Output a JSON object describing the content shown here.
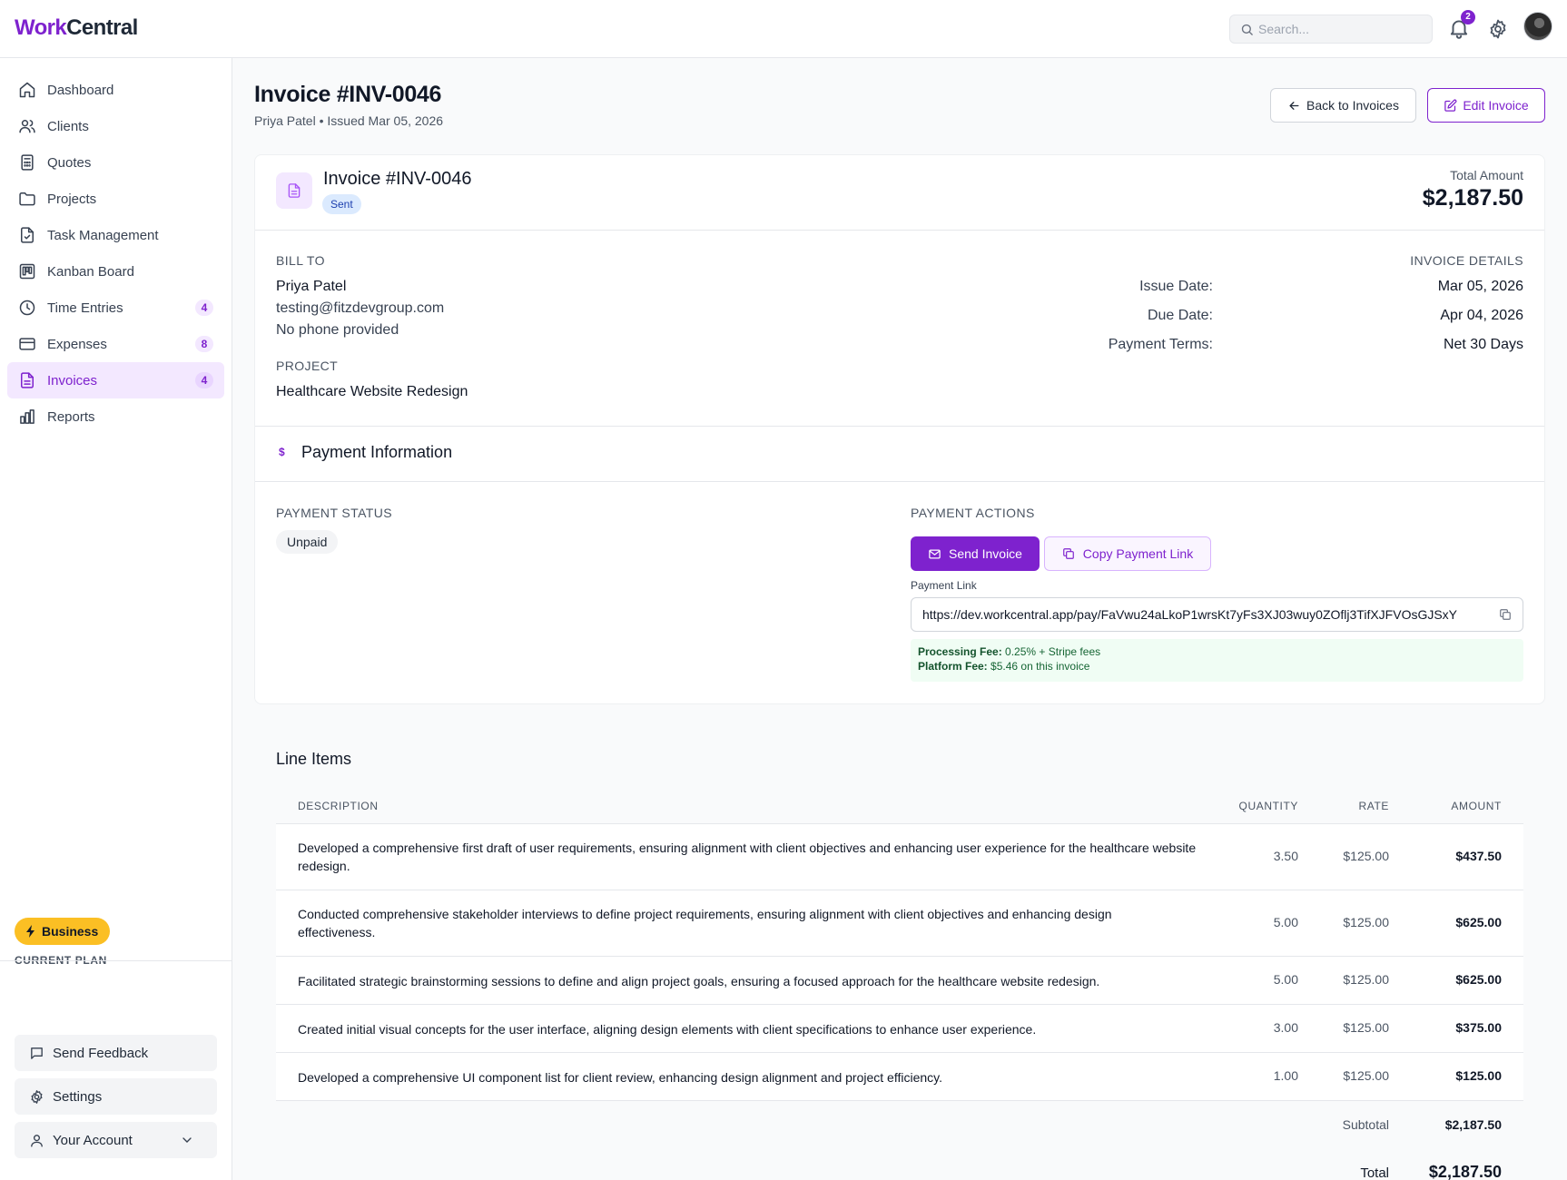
{
  "app": {
    "logo_part1": "Work",
    "logo_part2": "Central",
    "brand_color": "#7e22ce"
  },
  "topbar": {
    "search_placeholder": "Search...",
    "notification_count": "2",
    "icons": [
      "search-icon",
      "bell-icon",
      "gear-icon",
      "avatar"
    ]
  },
  "sidebar": {
    "items": [
      {
        "label": "Dashboard",
        "icon": "home-icon",
        "count": null,
        "active": false
      },
      {
        "label": "Clients",
        "icon": "users-icon",
        "count": null,
        "active": false
      },
      {
        "label": "Quotes",
        "icon": "calculator-icon",
        "count": null,
        "active": false
      },
      {
        "label": "Projects",
        "icon": "folder-icon",
        "count": null,
        "active": false
      },
      {
        "label": "Task Management",
        "icon": "file-check-icon",
        "count": null,
        "active": false
      },
      {
        "label": "Kanban Board",
        "icon": "kanban-icon",
        "count": null,
        "active": false
      },
      {
        "label": "Time Entries",
        "icon": "clock-icon",
        "count": "4",
        "active": false
      },
      {
        "label": "Expenses",
        "icon": "credit-card-icon",
        "count": "8",
        "active": false
      },
      {
        "label": "Invoices",
        "icon": "file-text-icon",
        "count": "4",
        "active": true
      },
      {
        "label": "Reports",
        "icon": "bar-chart-icon",
        "count": null,
        "active": false
      }
    ],
    "plan_label": "CURRENT PLAN",
    "plan_name": "Business",
    "feedback": "Send Feedback",
    "settings": "Settings",
    "account": "Your Account"
  },
  "header": {
    "title": "Invoice #INV-0046",
    "client": "Priya Patel",
    "separator": "•",
    "issued": "Issued Mar 05, 2026",
    "back_label": "Back to Invoices",
    "edit_label": "Edit Invoice"
  },
  "invoice": {
    "title": "Invoice #INV-0046",
    "status": "Sent",
    "total_label": "Total Amount",
    "total_value": "$2,187.50",
    "bill_to_label": "BILL TO",
    "client_name": "Priya Patel",
    "client_email": "testing@fitzdevgroup.com",
    "client_phone": "No phone provided",
    "project_label": "PROJECT",
    "project_name": "Healthcare Website Redesign",
    "details_label": "INVOICE DETAILS",
    "details": [
      {
        "key": "Issue Date:",
        "value": "Mar 05, 2026"
      },
      {
        "key": "Due Date:",
        "value": "Apr 04, 2026"
      },
      {
        "key": "Payment Terms:",
        "value": "Net 30 Days"
      }
    ]
  },
  "payment": {
    "section_icon": "$",
    "section_title": "Payment Information",
    "status_label": "PAYMENT STATUS",
    "status": "Unpaid",
    "actions_label": "PAYMENT ACTIONS",
    "send_label": "Send Invoice",
    "copy_label": "Copy Payment Link",
    "link_label": "Payment Link",
    "link_value": "https://dev.workcentral.app/pay/FaVwu24aLkoP1wrsKt7yFs3XJ03wuy0ZOflj3TifXJFVOsGJSxY",
    "processing_fee_label": "Processing Fee:",
    "processing_fee": "0.25% + Stripe fees",
    "platform_fee_label": "Platform Fee:",
    "platform_fee": "$5.46 on this invoice"
  },
  "line_items": {
    "title": "Line Items",
    "columns": {
      "description": "DESCRIPTION",
      "quantity": "QUANTITY",
      "rate": "RATE",
      "amount": "AMOUNT"
    },
    "rows": [
      {
        "description": "Developed a comprehensive first draft of user requirements, ensuring alignment with client objectives and enhancing user experience for the healthcare website redesign.",
        "quantity": "3.50",
        "rate": "$125.00",
        "amount": "$437.50"
      },
      {
        "description": "Conducted comprehensive stakeholder interviews to define project requirements, ensuring alignment with client objectives and enhancing design effectiveness.",
        "quantity": "5.00",
        "rate": "$125.00",
        "amount": "$625.00"
      },
      {
        "description": "Facilitated strategic brainstorming sessions to define and align project goals, ensuring a focused approach for the healthcare website redesign.",
        "quantity": "5.00",
        "rate": "$125.00",
        "amount": "$625.00"
      },
      {
        "description": "Created initial visual concepts for the user interface, aligning design elements with client specifications to enhance user experience.",
        "quantity": "3.00",
        "rate": "$125.00",
        "amount": "$375.00"
      },
      {
        "description": "Developed a comprehensive UI component list for client review, enhancing design alignment and project efficiency.",
        "quantity": "1.00",
        "rate": "$125.00",
        "amount": "$125.00"
      }
    ],
    "subtotal_label": "Subtotal",
    "subtotal": "$2,187.50",
    "total_label": "Total",
    "total": "$2,187.50"
  }
}
